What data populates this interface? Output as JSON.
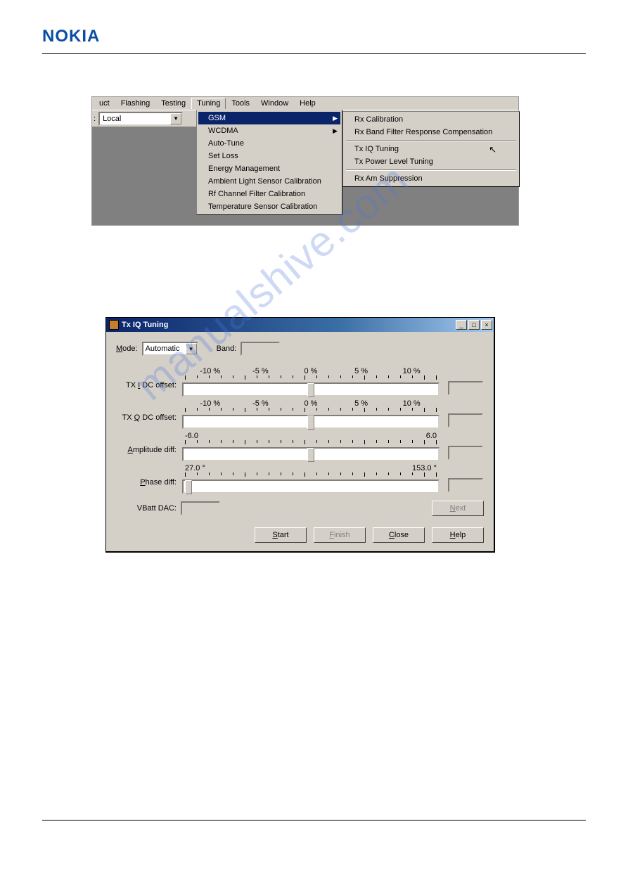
{
  "logo": "NOKIA",
  "watermark": "manualshive.com",
  "menubar": {
    "items": [
      "uct",
      "Flashing",
      "Testing",
      "Tuning",
      "Tools",
      "Window",
      "Help"
    ],
    "open_index": 3
  },
  "toolbar": {
    "mode_label": ":",
    "mode_value": "Local"
  },
  "tuning_menu": {
    "highlighted_index": 0,
    "items": [
      {
        "label": "GSM",
        "submenu": true
      },
      {
        "label": "WCDMA",
        "submenu": true
      },
      {
        "label": "Auto-Tune"
      },
      {
        "label": "Set Loss"
      },
      {
        "label": "Energy Management"
      },
      {
        "label": "Ambient Light Sensor Calibration"
      },
      {
        "label": "Rf Channel Filter Calibration"
      },
      {
        "label": "Temperature Sensor Calibration"
      }
    ]
  },
  "gsm_submenu": {
    "highlighted_index": 2,
    "groups": [
      [
        "Rx Calibration",
        "Rx Band Filter Response Compensation"
      ],
      [
        "Tx IQ Tuning",
        "Tx Power Level Tuning"
      ],
      [
        "Rx Am Suppression"
      ]
    ]
  },
  "dialog": {
    "title": "Tx IQ Tuning",
    "mode_label": "Mode:",
    "mode_underline": "M",
    "mode_value": "Automatic",
    "band_label": "Band:",
    "sliders": [
      {
        "label": "TX I DC offset:",
        "label_u": "I",
        "scale": [
          "-10 %",
          "-5 %",
          "0 %",
          "5 %",
          "10 %"
        ],
        "thumb_pct": 50
      },
      {
        "label": "TX Q DC offset:",
        "label_u": "Q",
        "scale": [
          "-10 %",
          "-5 %",
          "0 %",
          "5 %",
          "10 %"
        ],
        "thumb_pct": 50
      },
      {
        "label": "Amplitude diff:",
        "label_u": "A",
        "scale_ends": [
          "-6.0",
          "6.0"
        ],
        "thumb_pct": 50
      },
      {
        "label": "Phase diff:",
        "label_u": "P",
        "scale_ends": [
          "27.0 °",
          "153.0 °"
        ],
        "thumb_pct": 2
      }
    ],
    "vbatt_label": "VBatt DAC:",
    "next_btn": "Next",
    "next_u": "N",
    "buttons": [
      {
        "label": "Start",
        "u": "S",
        "disabled": false
      },
      {
        "label": "Finish",
        "u": "F",
        "disabled": true
      },
      {
        "label": "Close",
        "u": "C",
        "disabled": false
      },
      {
        "label": "Help",
        "u": "H",
        "disabled": false
      }
    ],
    "winbtns": [
      "_",
      "□",
      "×"
    ]
  }
}
